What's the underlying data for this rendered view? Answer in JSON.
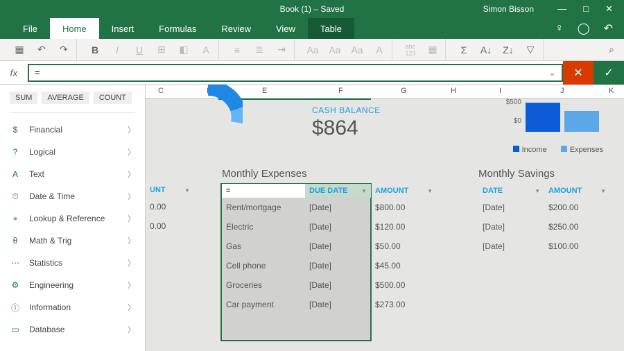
{
  "titlebar": {
    "title": "Book (1) – Saved",
    "user": "Simon Bisson"
  },
  "tabs": [
    "File",
    "Home",
    "Insert",
    "Formulas",
    "Review",
    "View",
    "Table"
  ],
  "active_tab": "Home",
  "formula": {
    "value": "="
  },
  "suggestion_chips": [
    "SUM",
    "AVERAGE",
    "COUNT"
  ],
  "categories": [
    {
      "icon": "$",
      "label": "Financial"
    },
    {
      "icon": "?",
      "label": "Logical"
    },
    {
      "icon": "A",
      "label": "Text"
    },
    {
      "icon": "⏱",
      "label": "Date & Time"
    },
    {
      "icon": "⌖",
      "label": "Lookup & Reference"
    },
    {
      "icon": "θ",
      "label": "Math & Trig"
    },
    {
      "icon": "⋯",
      "label": "Statistics"
    },
    {
      "icon": "⚙",
      "label": "Engineering"
    },
    {
      "icon": "ⓘ",
      "label": "Information"
    },
    {
      "icon": "▭",
      "label": "Database"
    }
  ],
  "columns": [
    "C",
    "D",
    "E",
    "F",
    "G",
    "H",
    "I",
    "J",
    "K"
  ],
  "cash": {
    "label": "CASH BALANCE",
    "value": "$864"
  },
  "chart": {
    "y1": "$500",
    "y2": "$0",
    "legend": [
      "Income",
      "Expenses"
    ]
  },
  "partial_col": {
    "header": "UNT",
    "rows": [
      "0.00",
      "0.00"
    ]
  },
  "expenses": {
    "title": "Monthly Expenses",
    "headers": [
      "",
      "DUE DATE",
      "AMOUNT"
    ],
    "editing": "=",
    "rows": [
      {
        "item": "Rent/mortgage",
        "date": "[Date]",
        "amount": "$800.00"
      },
      {
        "item": "Electric",
        "date": "[Date]",
        "amount": "$120.00"
      },
      {
        "item": "Gas",
        "date": "[Date]",
        "amount": "$50.00"
      },
      {
        "item": "Cell phone",
        "date": "[Date]",
        "amount": "$45.00"
      },
      {
        "item": "Groceries",
        "date": "[Date]",
        "amount": "$500.00"
      },
      {
        "item": "Car payment",
        "date": "[Date]",
        "amount": "$273.00"
      }
    ]
  },
  "savings": {
    "title": "Monthly Savings",
    "headers": [
      "DATE",
      "AMOUNT"
    ],
    "rows": [
      {
        "date": "[Date]",
        "amount": "$200.00"
      },
      {
        "date": "[Date]",
        "amount": "$250.00"
      },
      {
        "date": "[Date]",
        "amount": "$100.00"
      }
    ]
  },
  "chart_data": {
    "type": "bar",
    "categories": [
      "Income",
      "Expenses"
    ],
    "values": [
      700,
      500
    ],
    "ylim": [
      0,
      800
    ],
    "ylabel": "$"
  }
}
